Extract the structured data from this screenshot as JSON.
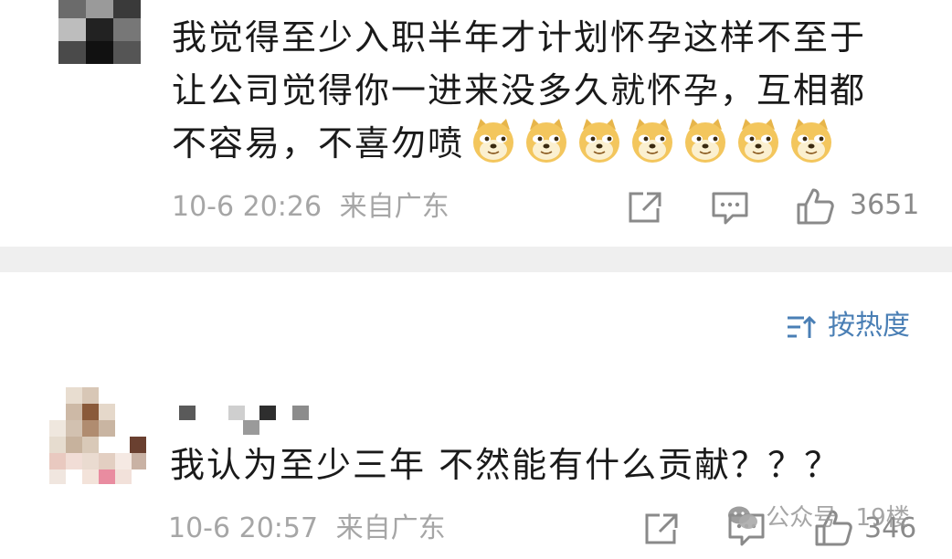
{
  "comment1": {
    "text_line1": "我觉得至少入职半年才计划怀孕这样不至于",
    "text_line2": "让公司觉得你一进来没多久就怀孕，互相都",
    "text_line3": "不容易，不喜勿喷",
    "emoji_count": 7,
    "timestamp": "10-6 20:26",
    "location": "来自广东",
    "like_count": "3651"
  },
  "sort": {
    "label": "按热度"
  },
  "comment2": {
    "text": "我认为至少三年 不然能有什么贡献？？？",
    "timestamp": "10-6 20:57",
    "location": "来自广东",
    "floor": "19楼",
    "like_count": "346",
    "watermark": "公众号"
  }
}
